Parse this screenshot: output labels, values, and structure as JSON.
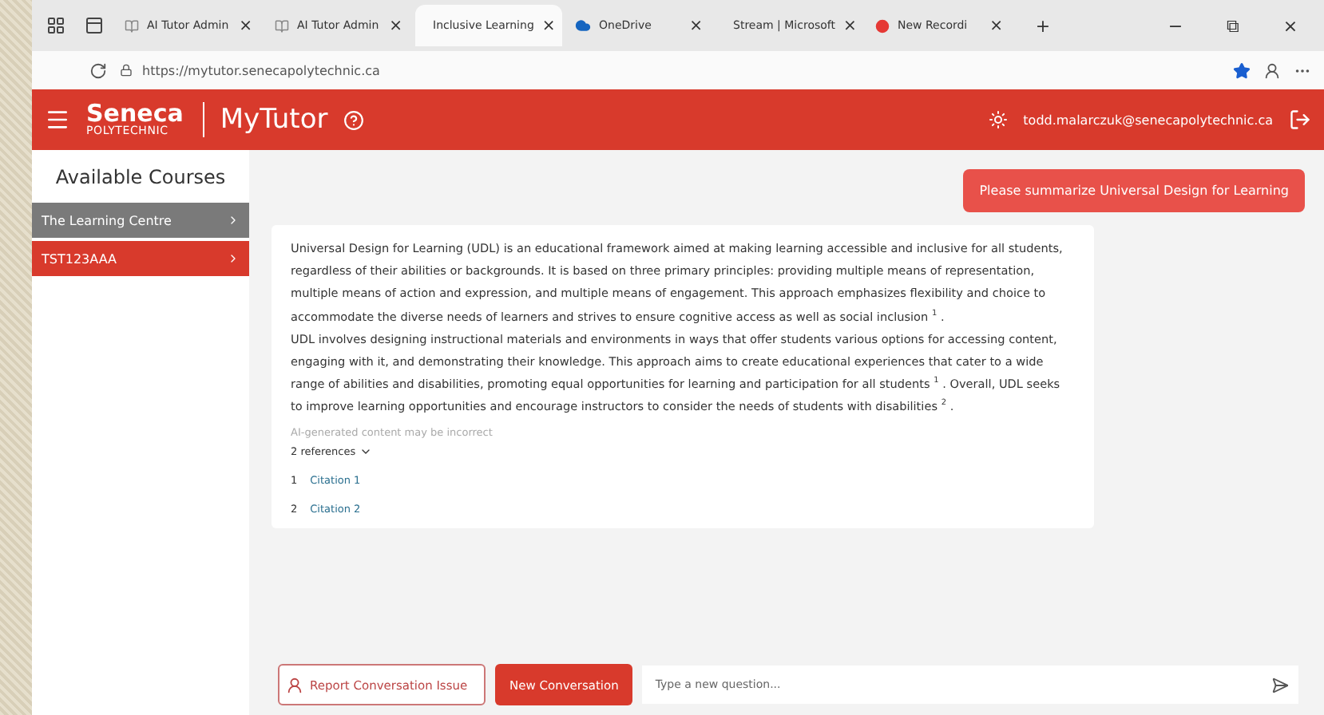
{
  "browser": {
    "tabs": [
      {
        "label": "AI Tutor Admin",
        "selected": false,
        "kind": "page"
      },
      {
        "label": "AI Tutor Admin",
        "selected": false,
        "kind": "page"
      },
      {
        "label": "Inclusive Learning",
        "selected": true,
        "kind": "page"
      },
      {
        "label": "OneDrive",
        "selected": false,
        "kind": "cloud"
      },
      {
        "label": "Stream | Microsoft",
        "selected": false,
        "kind": "stream"
      },
      {
        "label": "New Recordi",
        "selected": false,
        "kind": "recording"
      }
    ],
    "tab_close": "×",
    "new_tab": "+",
    "window_controls": [
      "−",
      "⧉",
      "×"
    ],
    "address": "https://mytutor.senecapolytechnic.ca"
  },
  "header": {
    "brand": "Seneca",
    "brand_sub": "POLYTECHNIC",
    "app_title": "MyTutor",
    "user_email": "todd.malarczuk@senecapolytechnic.ca"
  },
  "sidebar": {
    "title": "Available Courses",
    "items": [
      {
        "label": "The Learning Centre",
        "selected": true
      },
      {
        "label": "TST123AAA",
        "selected": false
      }
    ]
  },
  "chat": {
    "user_message": "Please summarize Universal Design for Learning",
    "answer_paragraphs": [
      "Universal Design for Learning (UDL) is an educational framework aimed at making learning accessible and inclusive for all students, regardless of their abilities or backgrounds. It is based on three primary principles: providing multiple means of representation, multiple means of action and expression, and multiple means of engagement. This approach emphasizes flexibility and choice to accommodate the diverse needs of learners and strives to ensure cognitive access as well as social inclusion $^{1}$ .",
      "UDL involves designing instructional materials and environments in ways that offer students various options for accessing content, engaging with it, and demonstrating their knowledge. This approach aims to create educational experiences that cater to a wide range of abilities and disabilities, promoting equal opportunities for learning and participation for all students $^{1}$ . Overall, UDL seeks to improve learning opportunities and encourage instructors to consider the needs of students with disabilities $^{2}$ ."
    ],
    "disclaimer": "AI-generated content may be incorrect",
    "references_toggle": "2 references",
    "references_expanded": true,
    "references": [
      {
        "number": "1",
        "label": "Citation 1"
      },
      {
        "number": "2",
        "label": "Citation 2"
      }
    ]
  },
  "footer": {
    "report_button": "Report Conversation Issue",
    "new_button": "New Conversation",
    "question_field": {
      "placeholder": "Type a new question..."
    }
  }
}
